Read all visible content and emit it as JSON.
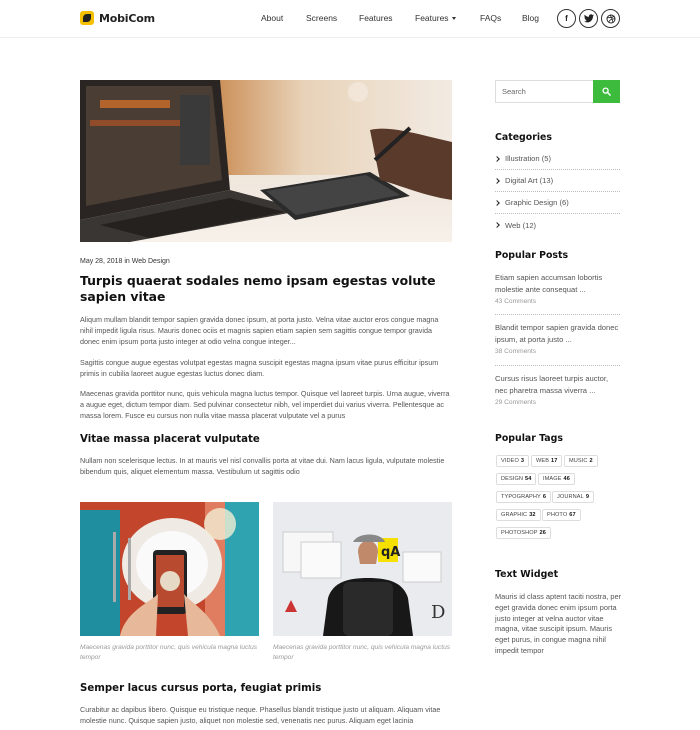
{
  "header": {
    "logo_text": "MobiCom",
    "nav": [
      {
        "label": "About"
      },
      {
        "label": "Screens"
      },
      {
        "label": "Features"
      },
      {
        "label": "Features",
        "dropdown": true
      },
      {
        "label": "FAQs"
      },
      {
        "label": "Blog"
      }
    ],
    "social": [
      {
        "icon": "facebook-icon",
        "glyph": "f"
      },
      {
        "icon": "twitter-icon",
        "glyph": "t"
      },
      {
        "icon": "dribbble-icon",
        "glyph": "⊛"
      }
    ]
  },
  "post": {
    "date": "May 28, 2018",
    "in_word": "in",
    "category": "Web Design",
    "title": "Turpis quaerat sodales nemo ipsam egestas volute sapien vitae",
    "paragraphs": [
      "Aliqum mullam blandit tempor sapien gravida donec ipsum, at porta justo. Velna vitae auctor eros congue magna nihil impedit ligula risus. Mauris donec ociis et magnis sapien etiam sapien sem sagittis congue tempor gravida donec enim ipsum porta justo integer at odio velna congue integer...",
      "Sagittis congue augue egestas volutpat egestas magna suscipit egestas magna ipsum vitae purus efficitur ipsum primis in cubilia laoreet augue egestas luctus donec diam.",
      "Maecenas gravida porttitor nunc, quis vehicula magna luctus tempor. Quisque vel laoreet turpis. Urna augue, viverra a augue eget, dictum tempor diam. Sed pulvinar consectetur nibh, vel imperdiet dui varius viverra. Pellentesque ac massa lorem. Fusce eu cursus non nulla vitae massa placerat vulputate vel a purus"
    ],
    "subheading_1": "Vitae massa placerat vulputate",
    "paragraph_4": "Nullam non scelerisque lectus. In at mauris vel nisl convallis porta at vitae dui. Nam lacus ligula, vulputate molestie bibendum quis, aliquet elementum massa. Vestibulum ut sagittis odio",
    "captions": [
      "Maecenas gravida porttitor nunc, quis vehicula magna luctus tempor",
      "Maecenas gravida porttitor nunc, quis vehicula magna luctus tempor"
    ],
    "subheading_2": "Semper lacus cursus porta, feugiat primis",
    "paragraph_5": "Curabitur ac dapibus libero. Quisque eu tristique neque. Phasellus blandit tristique justo ut aliquam. Aliquam vitae molestie nunc. Quisque sapien justo, aliquet non molestie sed, venenatis nec purus. Aliquam eget lacinia"
  },
  "sidebar": {
    "search_placeholder": "Search",
    "categories_title": "Categories",
    "categories": [
      {
        "label": "Illustration (5)"
      },
      {
        "label": "Digital Art (13)"
      },
      {
        "label": "Graphic Design (6)"
      },
      {
        "label": "Web (12)"
      }
    ],
    "popular_posts_title": "Popular Posts",
    "popular_posts": [
      {
        "title": "Etiam sapien accumsan lobortis molestie ante consequat ...",
        "comments": "43 Comments"
      },
      {
        "title": "Blandit tempor sapien gravida donec ipsum, at porta justo ...",
        "comments": "38 Comments"
      },
      {
        "title": "Cursus risus laoreet turpis auctor, nec pharetra massa viverra ...",
        "comments": "29 Comments"
      }
    ],
    "popular_tags_title": "Popular Tags",
    "tags": [
      {
        "name": "VIDEO",
        "count": "3"
      },
      {
        "name": "WEB",
        "count": "17"
      },
      {
        "name": "MUSIC",
        "count": "2"
      },
      {
        "name": "DESIGN",
        "count": "54"
      },
      {
        "name": "IMAGE",
        "count": "46"
      },
      {
        "name": "TYPOGRAPHY",
        "count": "6"
      },
      {
        "name": "JOURNAL",
        "count": "9"
      },
      {
        "name": "GRAPHIC",
        "count": "32"
      },
      {
        "name": "PHOTO",
        "count": "67"
      },
      {
        "name": "PHOTOSHOP",
        "count": "26"
      }
    ],
    "text_widget_title": "Text Widget",
    "text_widget_body": "Mauris id class aptent taciti nostra, per eget gravida donec enim ipsum porta justo integer at velna auctor vitae magna, vitae suscipit ipsum. Mauris eget purus, in congue magna nihil impedit tempor"
  },
  "colors": {
    "accent_green": "#3dbb3d",
    "logo_yellow": "#f5c000"
  }
}
